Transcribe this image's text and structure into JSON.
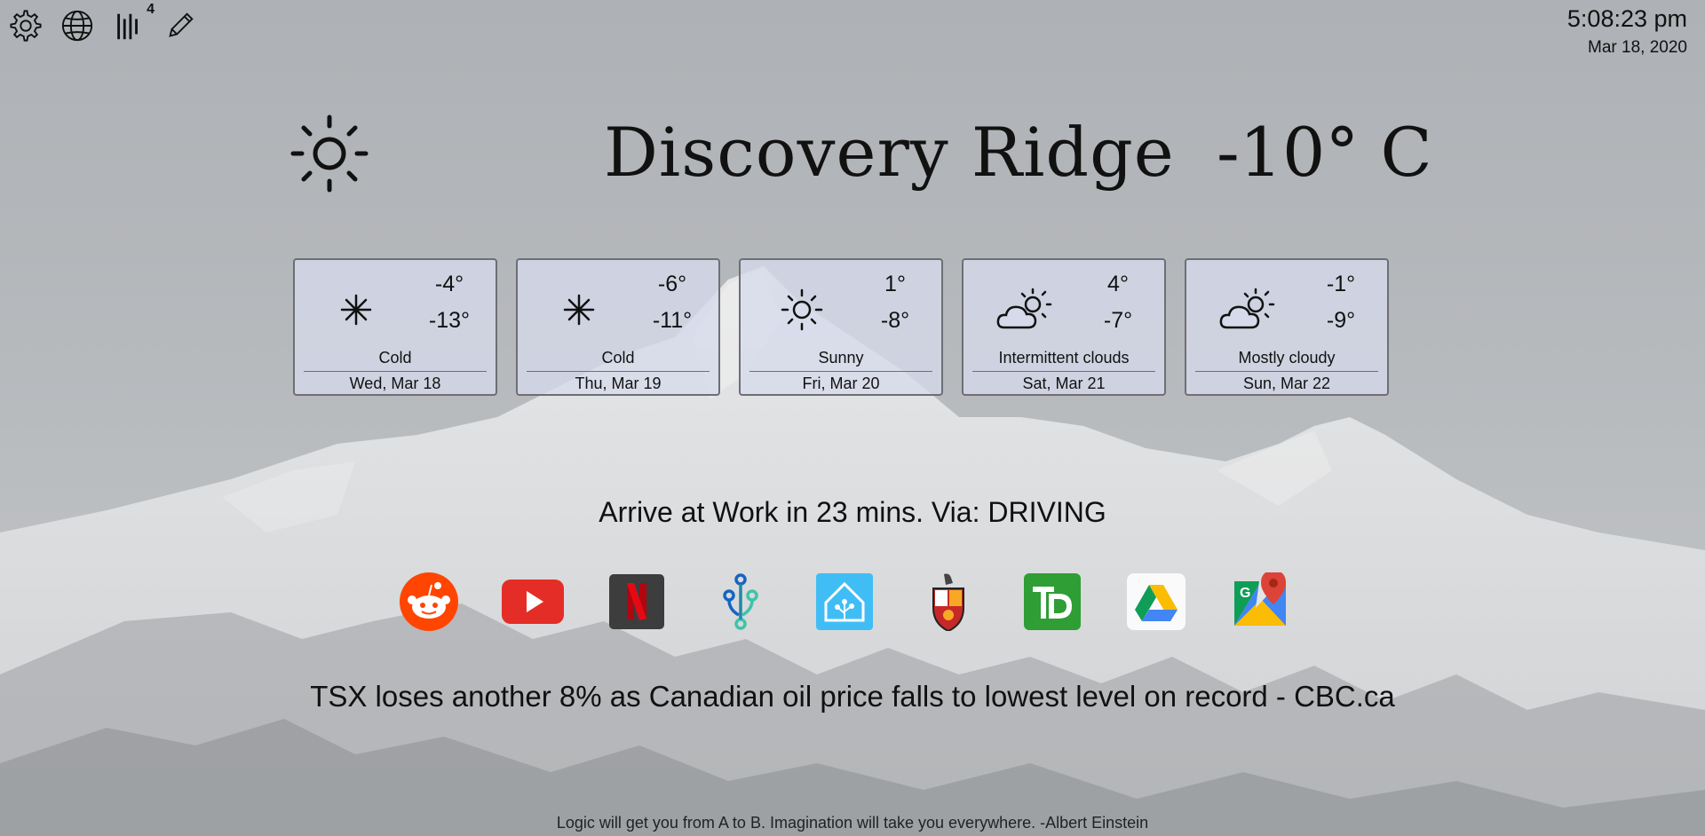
{
  "topbar": {
    "icons": [
      "gear-icon",
      "globe-icon",
      "bars-icon",
      "pencil-icon"
    ],
    "bars_badge": "4"
  },
  "clock": {
    "time": "5:08:23 pm",
    "date": "Mar 18, 2020"
  },
  "current": {
    "icon": "sun-icon",
    "location": "Discovery Ridge",
    "temperature": "-10° C"
  },
  "forecast": [
    {
      "icon": "snowflake-icon",
      "high": "-4°",
      "low": "-13°",
      "condition": "Cold",
      "day": "Wed, Mar 18"
    },
    {
      "icon": "snowflake-icon",
      "high": "-6°",
      "low": "-11°",
      "condition": "Cold",
      "day": "Thu, Mar 19"
    },
    {
      "icon": "sun-icon",
      "high": "1°",
      "low": "-8°",
      "condition": "Sunny",
      "day": "Fri, Mar 20"
    },
    {
      "icon": "partly-cloudy-icon",
      "high": "4°",
      "low": "-7°",
      "condition": "Intermittent clouds",
      "day": "Sat, Mar 21"
    },
    {
      "icon": "partly-cloudy-icon",
      "high": "-1°",
      "low": "-9°",
      "condition": "Mostly cloudy",
      "day": "Sun, Mar 22"
    }
  ],
  "commute": "Arrive at Work in 23 mins. Via: DRIVING",
  "shortcuts": [
    "reddit-icon",
    "youtube-icon",
    "netflix-icon",
    "source-control-icon",
    "home-assistant-icon",
    "crest-icon",
    "td-bank-icon",
    "google-drive-icon",
    "google-maps-icon"
  ],
  "headline": "TSX loses another 8% as Canadian oil price falls to lowest level on record - CBC.ca",
  "quote": "Logic will get you from A to B. Imagination will take you everywhere. -Albert Einstein",
  "colors": {
    "card_border": "#6d6f75",
    "card_bg": "#d6daeb",
    "reddit": "#ff4500",
    "youtube": "#e52d27",
    "netflix_red": "#e50914",
    "td_green": "#2e9e35",
    "home_assistant": "#41bdf5"
  }
}
